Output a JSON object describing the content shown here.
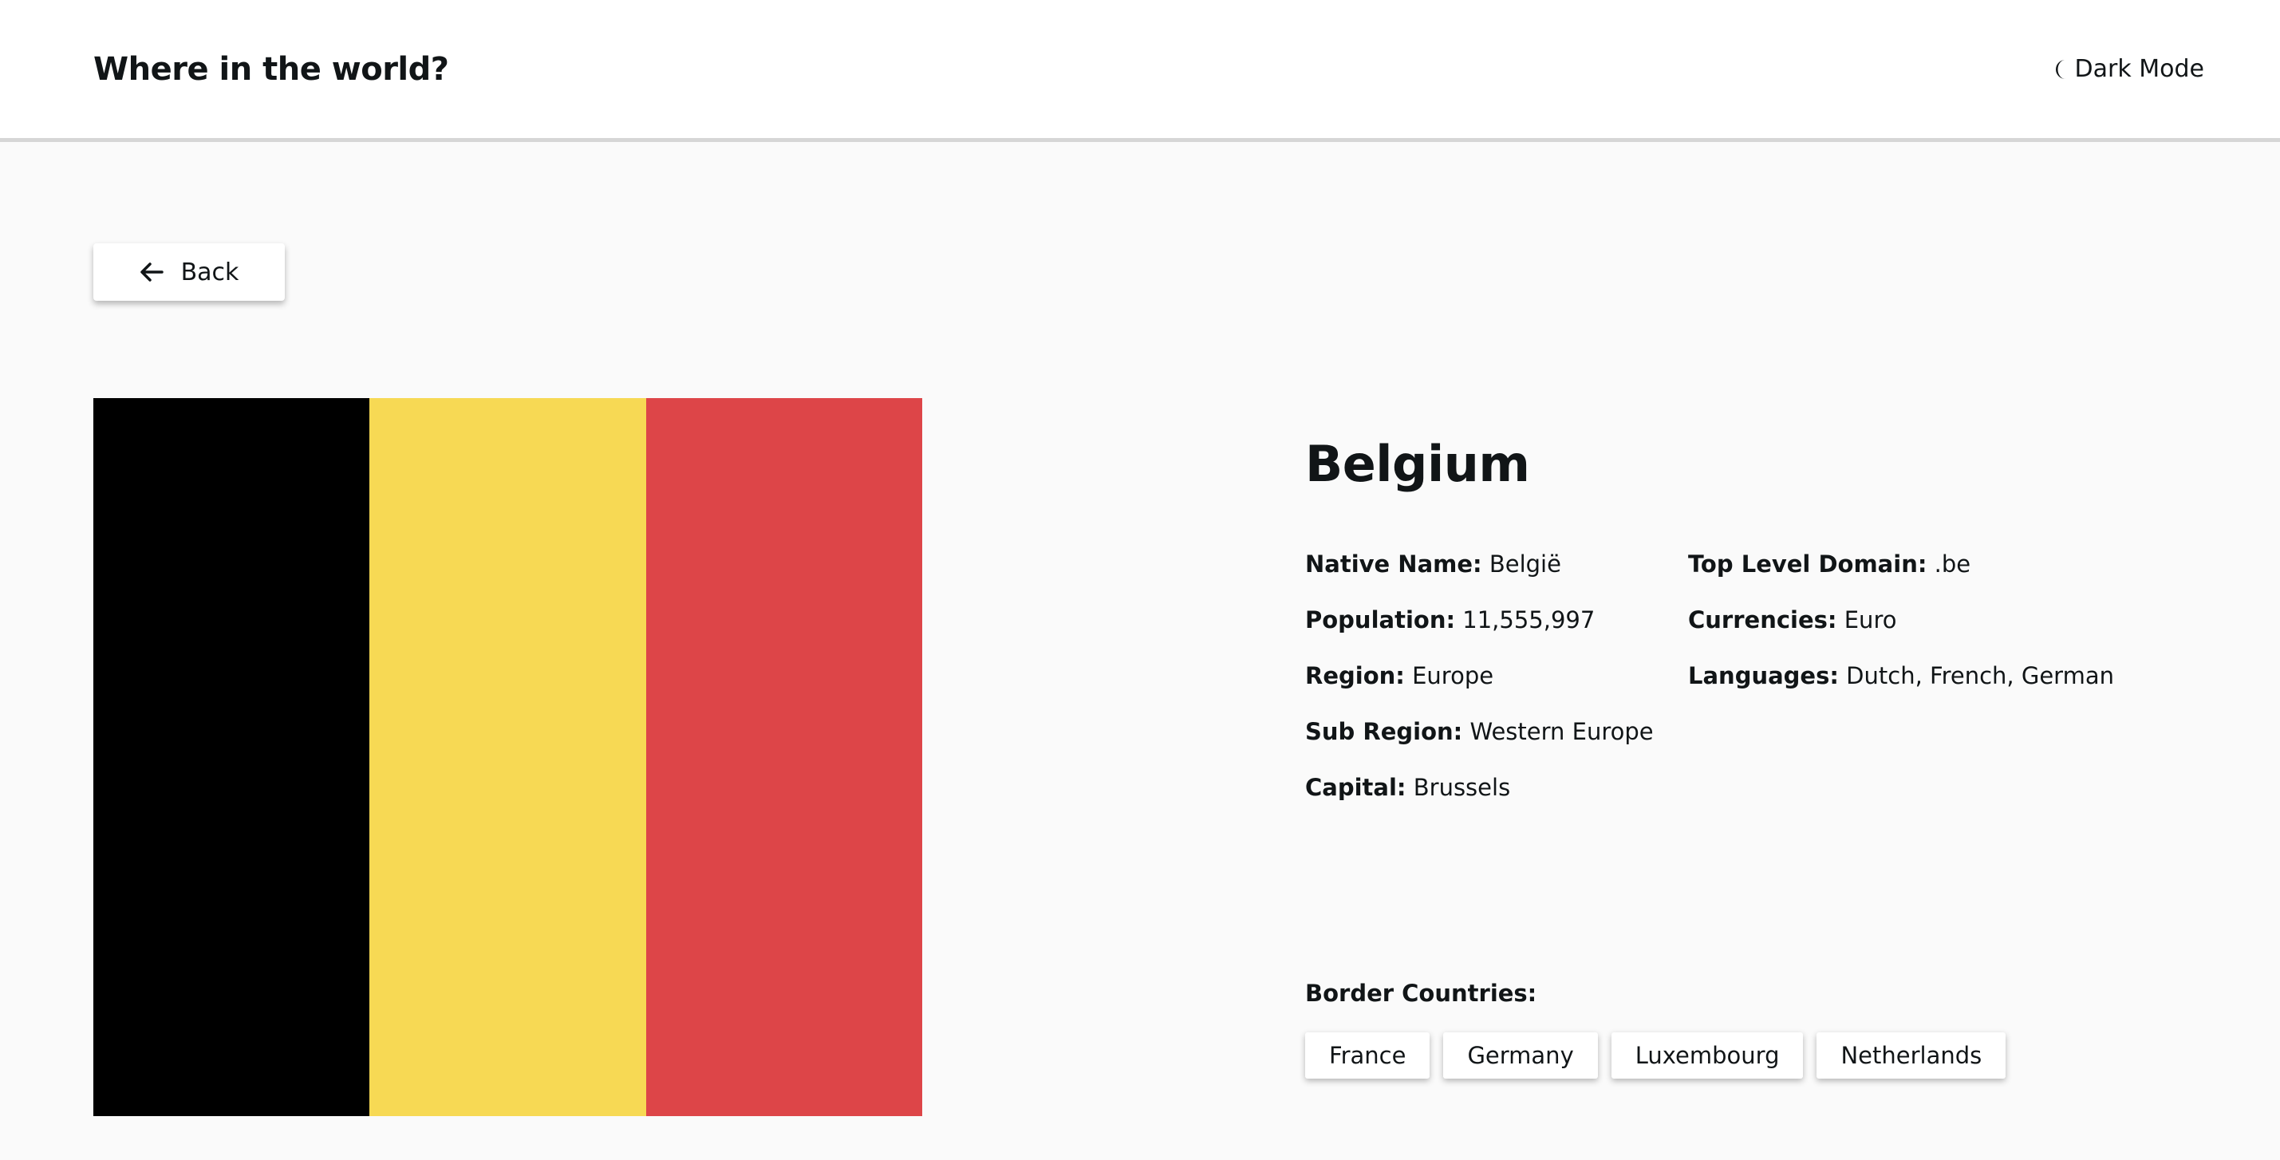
{
  "header": {
    "title": "Where in the world?",
    "theme_toggle_label": "Dark Mode",
    "theme_toggle_icon": "moon-icon"
  },
  "back_button": {
    "label": "Back",
    "icon": "arrow-left-icon"
  },
  "flag": {
    "stripe_colors": [
      "#000000",
      "#f7d954",
      "#dd4548"
    ]
  },
  "country": {
    "name": "Belgium",
    "native_name_label": "Native Name:",
    "native_name": "België",
    "population_label": "Population:",
    "population": "11,555,997",
    "region_label": "Region:",
    "region": "Europe",
    "sub_region_label": "Sub Region:",
    "sub_region": "Western Europe",
    "capital_label": "Capital:",
    "capital": "Brussels",
    "tld_label": "Top Level Domain:",
    "tld": ".be",
    "currencies_label": "Currencies:",
    "currencies": "Euro",
    "languages_label": "Languages:",
    "languages": "Dutch, French, German"
  },
  "borders": {
    "label": "Border Countries:",
    "countries": [
      "France",
      "Germany",
      "Luxembourg",
      "Netherlands"
    ]
  }
}
